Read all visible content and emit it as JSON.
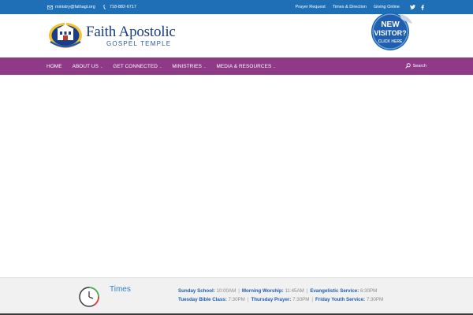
{
  "topbar": {
    "email": "ministry@fathagt.org",
    "phone": "718-882-6717",
    "links": [
      "Prayer Request",
      "Times & Direction",
      "Giving Online"
    ],
    "social": [
      "twitter-icon",
      "facebook-icon"
    ]
  },
  "header": {
    "logo_title": "Faith Apostolic",
    "logo_subtitle": "GOSPEL   TEMPLE",
    "badge_line1": "NEW",
    "badge_line2": "VISITOR?",
    "badge_line3": "CLICK HERE"
  },
  "nav": {
    "items": [
      {
        "label": "HOME",
        "has_submenu": false
      },
      {
        "label": "ABOUT US",
        "has_submenu": true
      },
      {
        "label": "GET CONNECTED",
        "has_submenu": true
      },
      {
        "label": "MINISTRIES",
        "has_submenu": true
      },
      {
        "label": "MEDIA & RESOURCES",
        "has_submenu": true
      }
    ],
    "search_label": "Search"
  },
  "times": {
    "title": "Times",
    "row1": [
      {
        "label": "Sunday School:",
        "value": "10:00AM"
      },
      {
        "label": "Morning Worship:",
        "value": "11:45AM"
      },
      {
        "label": "Evangelistic Service:",
        "value": "6:30PM"
      }
    ],
    "row2": [
      {
        "label": "Tuesday Bible Class:",
        "value": "7:30PM"
      },
      {
        "label": "Thursday Prayer:",
        "value": "7:30PM"
      },
      {
        "label": "Friday Youth Service:",
        "value": "7:30PM"
      }
    ]
  },
  "colors": {
    "topbar": "#1f6fb6",
    "nav": "#8e3a87",
    "accent_blue": "#2e7fc9"
  }
}
